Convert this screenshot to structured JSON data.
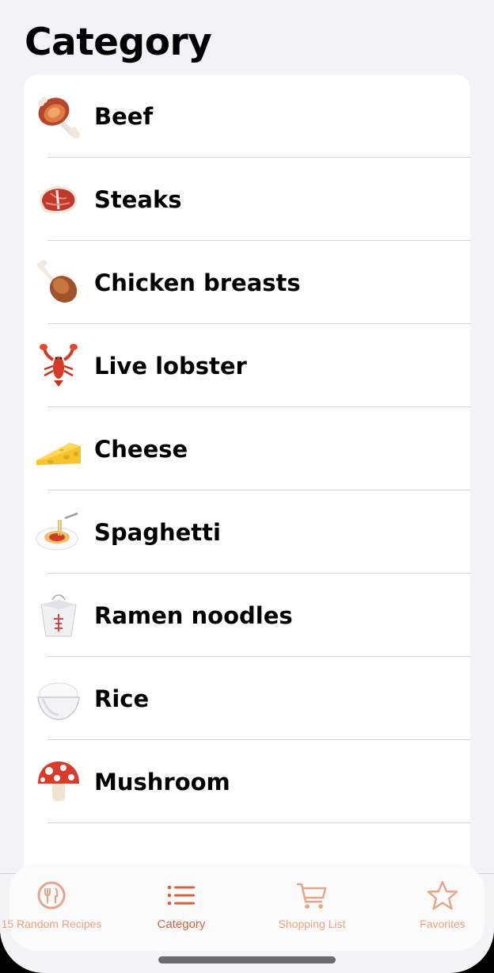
{
  "header": {
    "title": "Category"
  },
  "categories": [
    {
      "label": "Beef",
      "icon": "meat-on-bone-icon"
    },
    {
      "label": "Steaks",
      "icon": "steak-icon"
    },
    {
      "label": "Chicken breasts",
      "icon": "poultry-leg-icon"
    },
    {
      "label": "Live lobster",
      "icon": "lobster-icon"
    },
    {
      "label": "Cheese",
      "icon": "cheese-wedge-icon"
    },
    {
      "label": "Spaghetti",
      "icon": "spaghetti-icon"
    },
    {
      "label": "Ramen noodles",
      "icon": "takeout-box-icon"
    },
    {
      "label": "Rice",
      "icon": "rice-bowl-icon"
    },
    {
      "label": "Mushroom",
      "icon": "mushroom-icon"
    }
  ],
  "tabbar": {
    "tabs": [
      {
        "label": "15 Random Recipes",
        "icon": "fork-knife-plate-icon",
        "active": false
      },
      {
        "label": "Category",
        "icon": "list-icon",
        "active": true
      },
      {
        "label": "Shopping List",
        "icon": "cart-icon",
        "active": false
      },
      {
        "label": "Favorites",
        "icon": "star-icon",
        "active": false
      }
    ]
  },
  "colors": {
    "accent": "#d9623f",
    "accent_inactive": "#e8a489",
    "background": "#f2f2f7"
  }
}
